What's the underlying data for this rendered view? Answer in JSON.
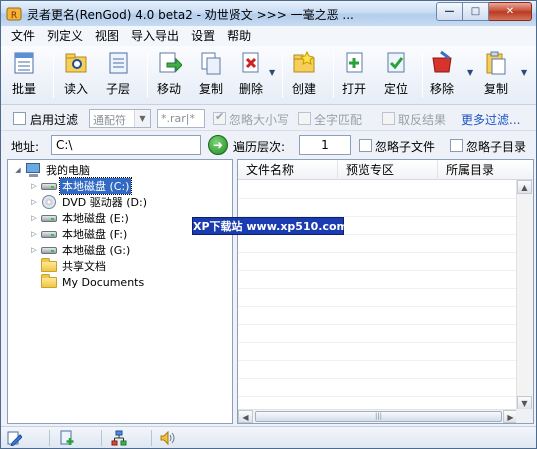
{
  "window": {
    "title": "灵者更名(RenGod) 4.0 beta2 - 劝世贤文 >>>   一毫之恶 ...",
    "minimize_label": "—",
    "maximize_label": "□",
    "close_label": "✕"
  },
  "menu": [
    "文件",
    "列定义",
    "视图",
    "导入导出",
    "设置",
    "帮助"
  ],
  "toolbar": {
    "batch": "批量",
    "read": "读入",
    "sublevel": "子层",
    "move": "移动",
    "copy": "复制",
    "delete": "删除",
    "create": "创建",
    "open": "打开",
    "locate": "定位",
    "remove": "移除",
    "copy2": "复制"
  },
  "filter": {
    "enable_label": "启用过滤",
    "wildcard_value": "通配符",
    "pattern_value": "*.rar|*",
    "ignore_case_label": "忽略大小写",
    "full_match_label": "全字匹配",
    "invert_label": "取反结果",
    "more_link": "更多过滤..."
  },
  "address": {
    "label": "地址:",
    "value": "C:\\",
    "depth_label": "遍历层次:",
    "depth_value": "1",
    "ignore_files_label": "忽略子文件",
    "ignore_dirs_label": "忽略子目录"
  },
  "tree": {
    "root": "我的电脑",
    "items": [
      {
        "label": "本地磁盘 (C:)",
        "icon": "drive-icon",
        "selected": true
      },
      {
        "label": "DVD 驱动器 (D:)",
        "icon": "dvd-icon"
      },
      {
        "label": "本地磁盘 (E:)",
        "icon": "drive-icon"
      },
      {
        "label": "本地磁盘 (F:)",
        "icon": "drive-icon"
      },
      {
        "label": "本地磁盘 (G:)",
        "icon": "drive-icon"
      },
      {
        "label": "共享文档",
        "icon": "folder-icon"
      },
      {
        "label": "My Documents",
        "icon": "folder-icon"
      }
    ]
  },
  "list": {
    "columns": [
      "文件名称",
      "预览专区",
      "所属目录"
    ]
  },
  "watermark": "XP下载站 www.xp510.com"
}
